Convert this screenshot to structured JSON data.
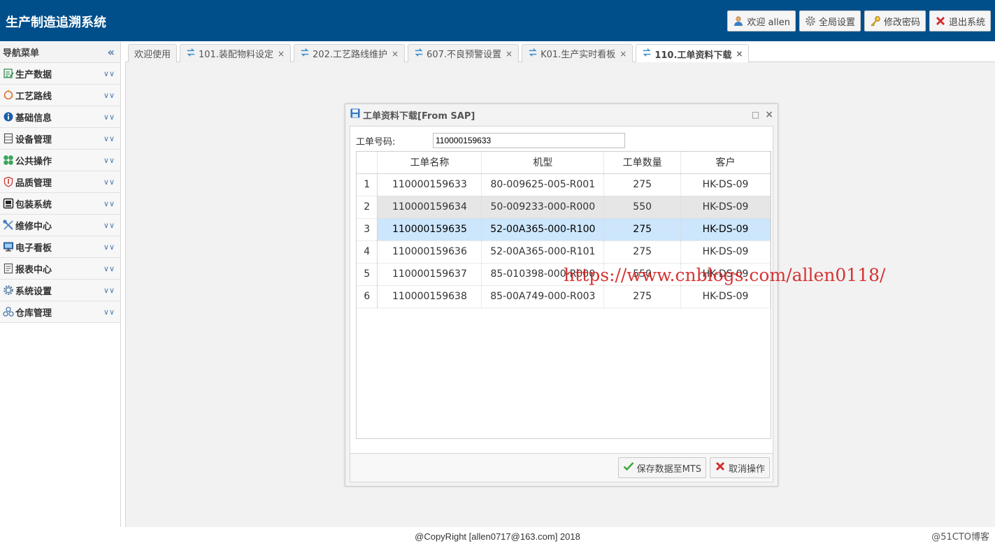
{
  "header": {
    "app_title": "生产制造追溯系统",
    "buttons": [
      {
        "label": "欢迎 allen",
        "icon": "user-icon"
      },
      {
        "label": "全局设置",
        "icon": "gear-icon"
      },
      {
        "label": "修改密码",
        "icon": "key-icon"
      },
      {
        "label": "退出系统",
        "icon": "close-icon"
      }
    ]
  },
  "sidebar": {
    "title": "导航菜单",
    "collapse_glyph": "«",
    "items": [
      {
        "label": "生产数据",
        "icon": "edit-list-icon"
      },
      {
        "label": "工艺路线",
        "icon": "route-icon"
      },
      {
        "label": "基础信息",
        "icon": "info-icon"
      },
      {
        "label": "设备管理",
        "icon": "device-icon"
      },
      {
        "label": "公共操作",
        "icon": "clover-icon"
      },
      {
        "label": "品质管理",
        "icon": "shield-icon"
      },
      {
        "label": "包装系统",
        "icon": "package-icon"
      },
      {
        "label": "维修中心",
        "icon": "tools-icon"
      },
      {
        "label": "电子看板",
        "icon": "monitor-icon"
      },
      {
        "label": "报表中心",
        "icon": "report-icon"
      },
      {
        "label": "系统设置",
        "icon": "settings-icon"
      },
      {
        "label": "仓库管理",
        "icon": "warehouse-icon"
      }
    ]
  },
  "tabs": [
    {
      "label": "欢迎使用",
      "closable": false,
      "active": false
    },
    {
      "label": "101.装配物料设定",
      "closable": true,
      "active": false
    },
    {
      "label": "202.工艺路线维护",
      "closable": true,
      "active": false
    },
    {
      "label": "607.不良预警设置",
      "closable": true,
      "active": false
    },
    {
      "label": "K01.生产实时看板",
      "closable": true,
      "active": false
    },
    {
      "label": "110.工单资料下载",
      "closable": true,
      "active": true
    }
  ],
  "dialog": {
    "title": "工单资料下载[From SAP]",
    "field_label": "工单号码:",
    "field_value": "110000159633",
    "columns": [
      "工单名称",
      "机型",
      "工单数量",
      "客户"
    ],
    "rows": [
      {
        "no": "1",
        "name": "110000159633",
        "model": "80-009625-005-R001",
        "qty": "275",
        "customer": "HK-DS-09"
      },
      {
        "no": "2",
        "name": "110000159634",
        "model": "50-009233-000-R000",
        "qty": "550",
        "customer": "HK-DS-09"
      },
      {
        "no": "3",
        "name": "110000159635",
        "model": "52-00A365-000-R100",
        "qty": "275",
        "customer": "HK-DS-09"
      },
      {
        "no": "4",
        "name": "110000159636",
        "model": "52-00A365-000-R101",
        "qty": "275",
        "customer": "HK-DS-09"
      },
      {
        "no": "5",
        "name": "110000159637",
        "model": "85-010398-000-R000",
        "qty": "550",
        "customer": "HK-DS-09"
      },
      {
        "no": "6",
        "name": "110000159638",
        "model": "85-00A749-000-R003",
        "qty": "275",
        "customer": "HK-DS-09"
      }
    ],
    "selected_row": 3,
    "hover_row": 2,
    "save_label": "保存数据至MTS",
    "cancel_label": "取消操作"
  },
  "watermark": "https://www.cnblogs.com/allen0118/",
  "footer": "@CopyRight [allen0717@163.com] 2018",
  "corner_mark": "@51CTO博客",
  "colors": {
    "header_bg": "#004f8a",
    "selected_row": "#cde6fb",
    "hover_row": "#e6e6e6"
  }
}
